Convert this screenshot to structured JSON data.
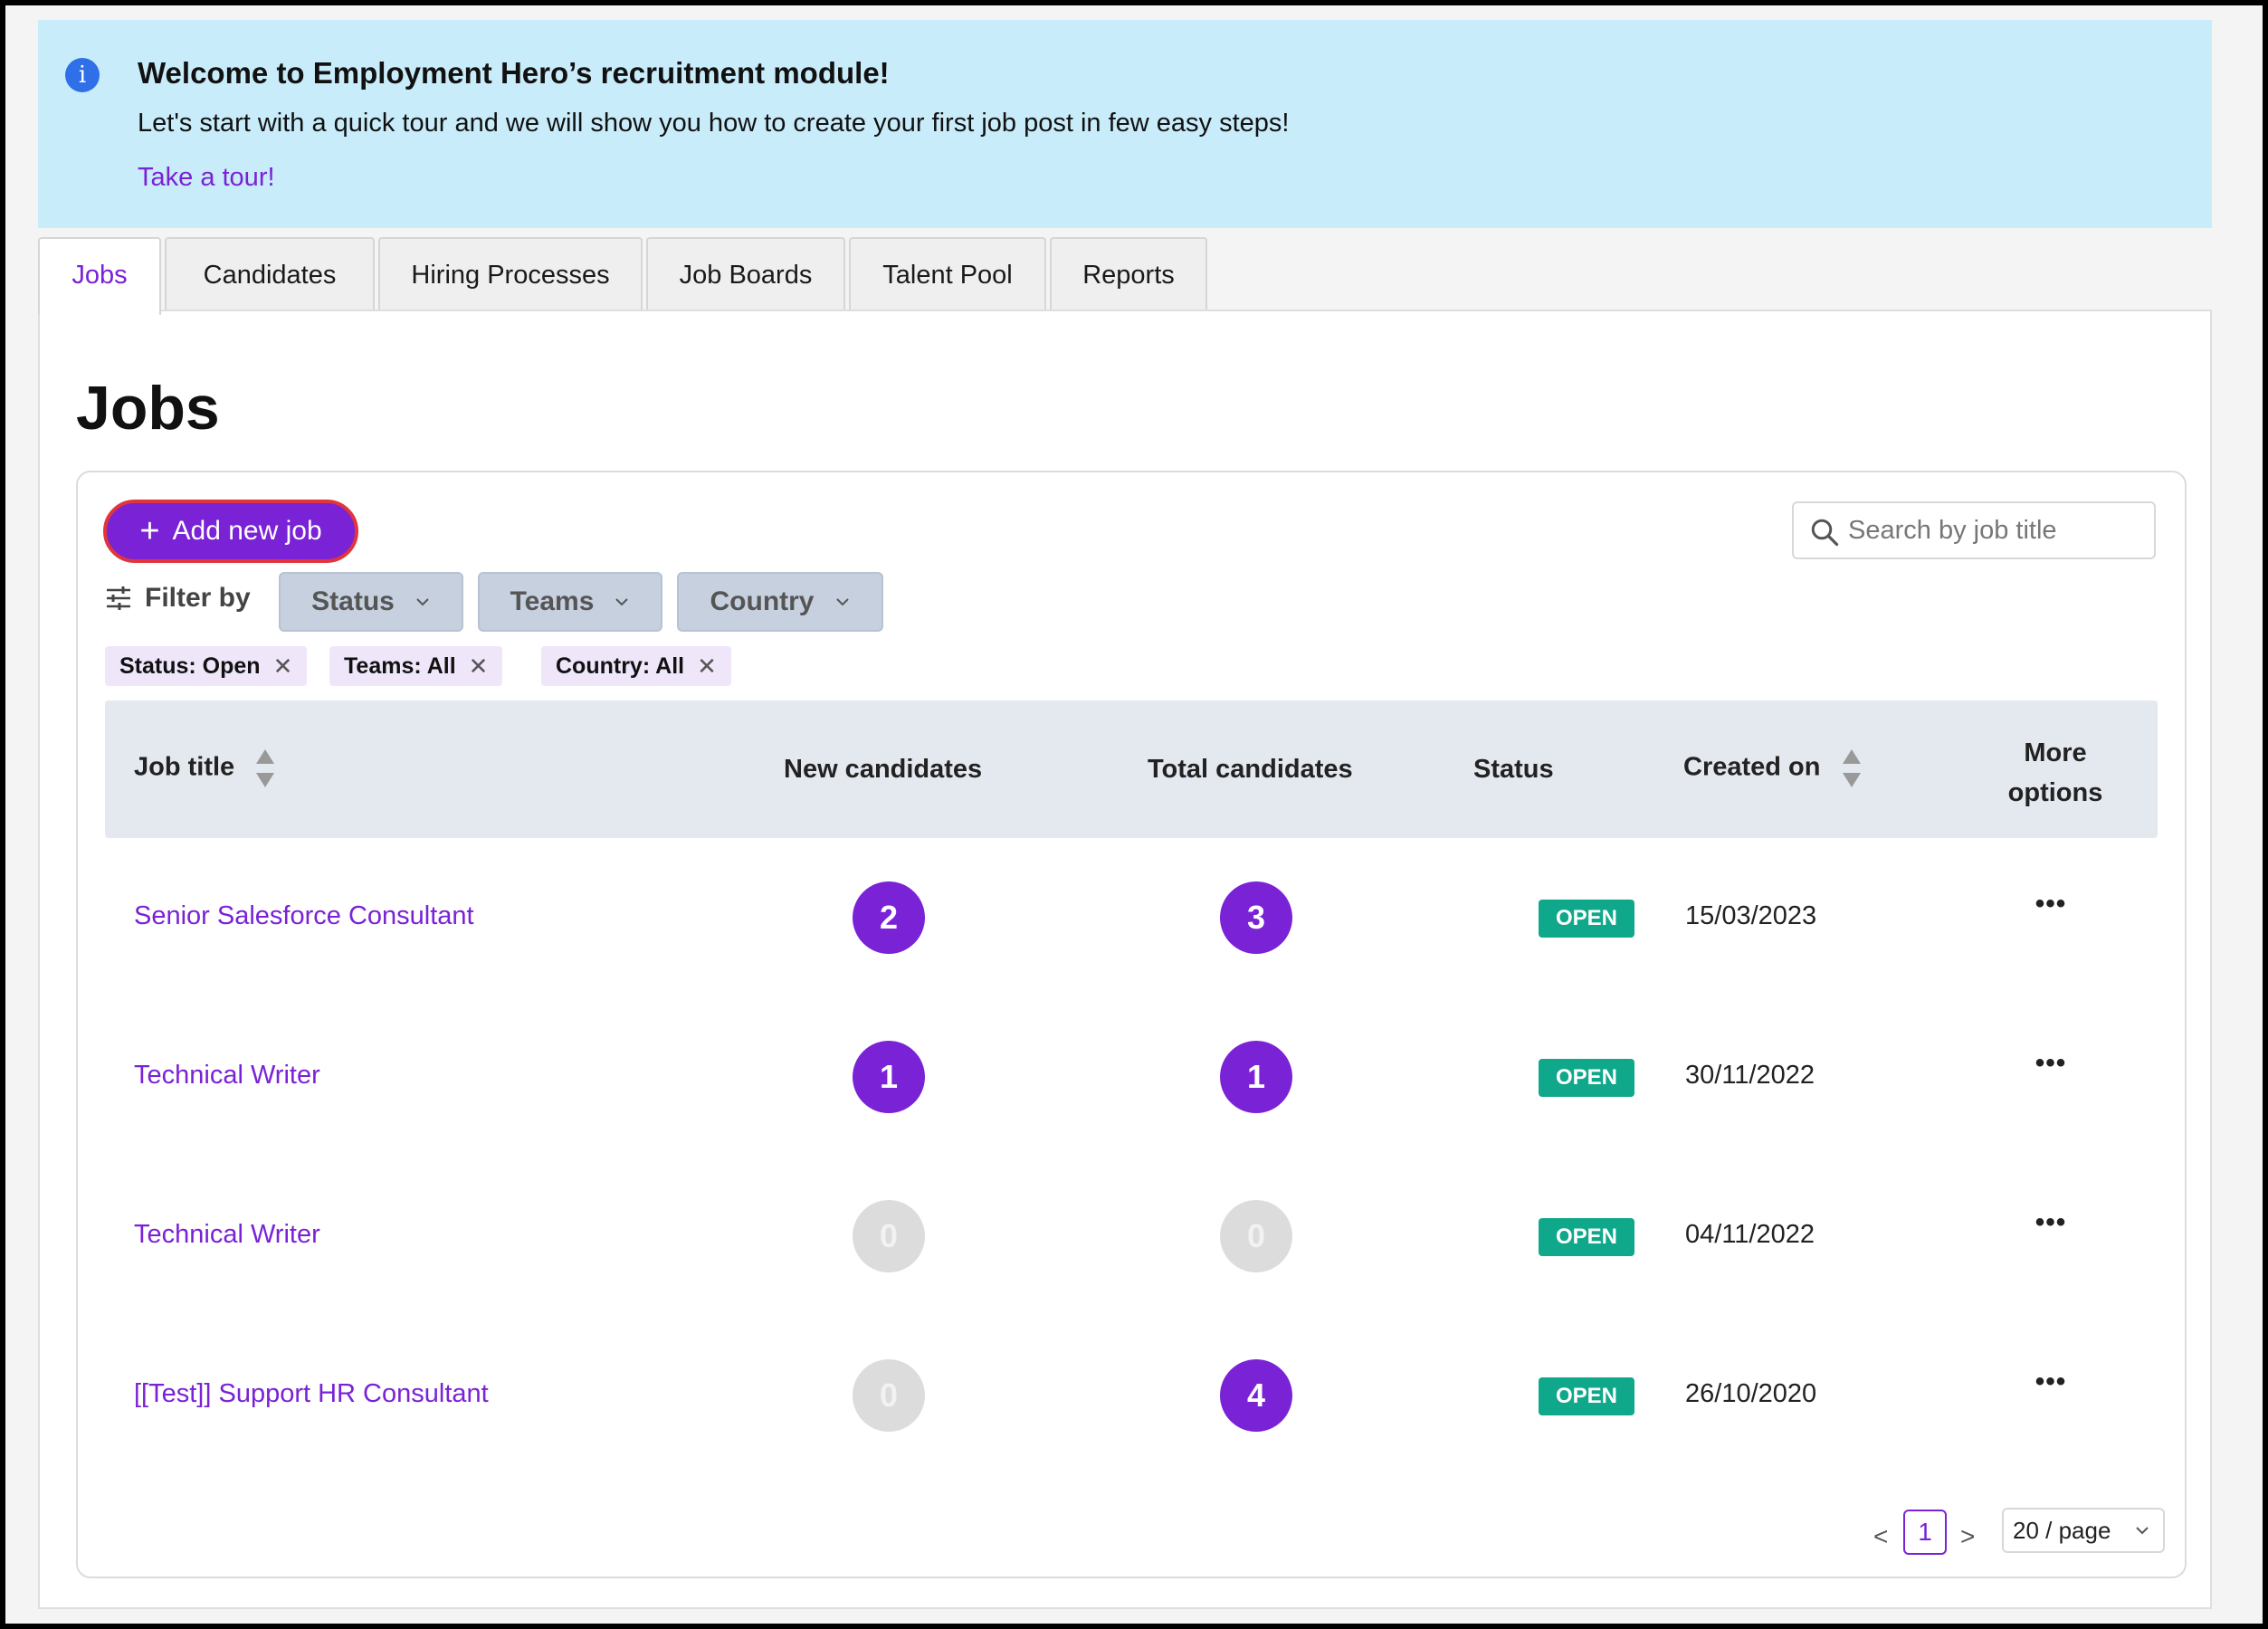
{
  "banner": {
    "icon": "info-icon",
    "title": "Welcome to Employment Hero’s recruitment module!",
    "text": "Let's start with a quick tour and we will show you how to create your first job post in few easy steps!",
    "link": "Take a tour!"
  },
  "tabs": [
    {
      "label": "Jobs",
      "active": true
    },
    {
      "label": "Candidates"
    },
    {
      "label": "Hiring Processes"
    },
    {
      "label": "Job Boards"
    },
    {
      "label": "Talent Pool"
    },
    {
      "label": "Reports"
    }
  ],
  "page": {
    "title": "Jobs"
  },
  "toolbar": {
    "add_label": "Add new job",
    "search_placeholder": "Search by job title",
    "filter_label": "Filter by",
    "filters": [
      "Status",
      "Teams",
      "Country"
    ],
    "chips": [
      "Status: Open",
      "Teams: All",
      "Country: All"
    ]
  },
  "table": {
    "headers": {
      "job_title": "Job title",
      "new_candidates": "New candidates",
      "total_candidates": "Total candidates",
      "status": "Status",
      "created_on": "Created on",
      "more_options_1": "More",
      "more_options_2": "options"
    },
    "rows": [
      {
        "title": "Senior Salesforce Consultant",
        "new": "2",
        "total": "3",
        "status": "OPEN",
        "created": "15/03/2023",
        "more": "•••"
      },
      {
        "title": "Technical Writer",
        "new": "1",
        "total": "1",
        "status": "OPEN",
        "created": "30/11/2022",
        "more": "•••"
      },
      {
        "title": "Technical Writer",
        "new": "0",
        "total": "0",
        "status": "OPEN",
        "created": "04/11/2022",
        "more": "•••"
      },
      {
        "title": "[[Test]] Support HR Consultant",
        "new": "0",
        "total": "4",
        "status": "OPEN",
        "created": "26/10/2020",
        "more": "•••"
      }
    ]
  },
  "pagination": {
    "prev": "<",
    "current": "1",
    "next": ">",
    "page_size": "20 / page"
  },
  "colors": {
    "accent": "#7a22d6",
    "open": "#0fa88a",
    "banner": "#c9ecfa"
  }
}
